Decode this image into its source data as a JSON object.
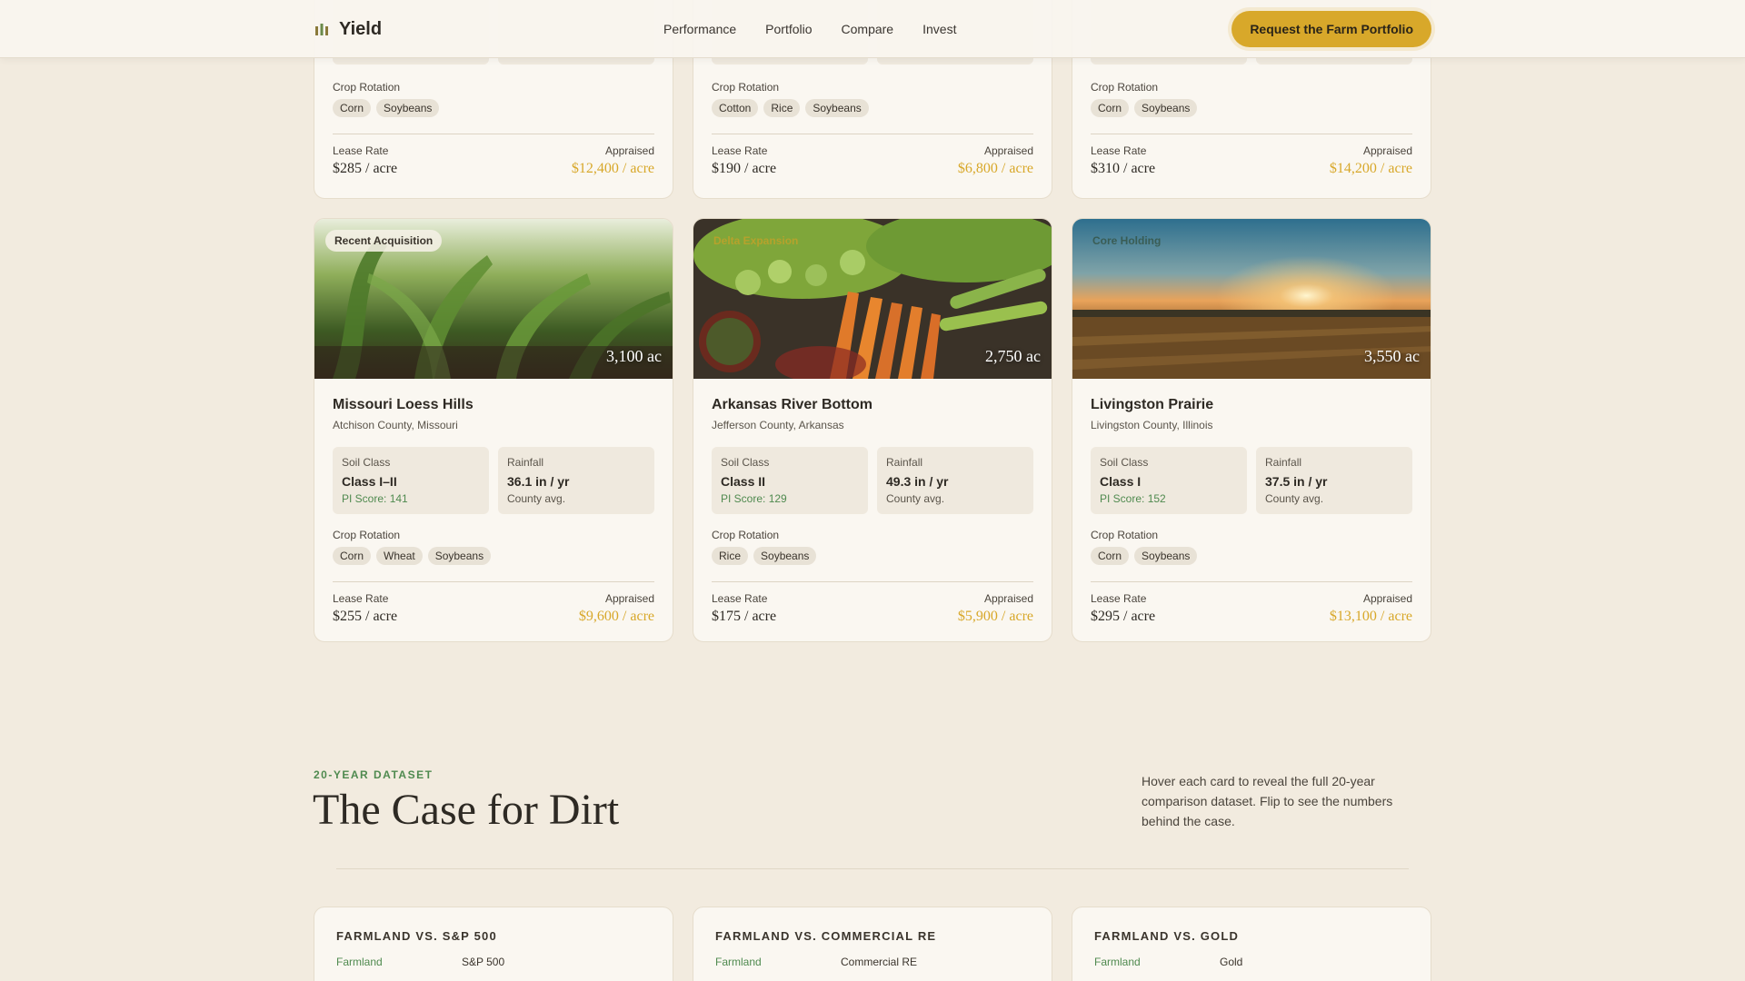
{
  "header": {
    "brand": "Yield",
    "nav": [
      "Performance",
      "Portfolio",
      "Compare",
      "Invest"
    ],
    "cta": "Request the Farm Portfolio"
  },
  "top_cards": [
    {
      "rotation_label": "Crop Rotation",
      "crops": [
        "Corn",
        "Soybeans"
      ],
      "lease_label": "Lease Rate",
      "lease": "$285 / acre",
      "appraised_label": "Appraised",
      "appraised": "$12,400 / acre"
    },
    {
      "rotation_label": "Crop Rotation",
      "crops": [
        "Cotton",
        "Rice",
        "Soybeans"
      ],
      "lease_label": "Lease Rate",
      "lease": "$190 / acre",
      "appraised_label": "Appraised",
      "appraised": "$6,800 / acre"
    },
    {
      "rotation_label": "Crop Rotation",
      "crops": [
        "Corn",
        "Soybeans"
      ],
      "lease_label": "Lease Rate",
      "lease": "$310 / acre",
      "appraised_label": "Appraised",
      "appraised": "$14,200 / acre"
    }
  ],
  "cards": [
    {
      "badge": "Recent Acquisition",
      "acres": "3,100 ac",
      "title": "Missouri Loess Hills",
      "location": "Atchison County, Missouri",
      "soil_label": "Soil Class",
      "soil": "Class I–II",
      "pi": "PI Score: 141",
      "rain_label": "Rainfall",
      "rain": "36.1 in / yr",
      "rain_note": "County avg.",
      "rotation_label": "Crop Rotation",
      "crops": [
        "Corn",
        "Wheat",
        "Soybeans"
      ],
      "lease_label": "Lease Rate",
      "lease": "$255 / acre",
      "appraised_label": "Appraised",
      "appraised": "$9,600 / acre"
    },
    {
      "badge": "Delta Expansion",
      "acres": "2,750 ac",
      "title": "Arkansas River Bottom",
      "location": "Jefferson County, Arkansas",
      "soil_label": "Soil Class",
      "soil": "Class II",
      "pi": "PI Score: 129",
      "rain_label": "Rainfall",
      "rain": "49.3 in / yr",
      "rain_note": "County avg.",
      "rotation_label": "Crop Rotation",
      "crops": [
        "Rice",
        "Soybeans"
      ],
      "lease_label": "Lease Rate",
      "lease": "$175 / acre",
      "appraised_label": "Appraised",
      "appraised": "$5,900 / acre"
    },
    {
      "badge": "Core Holding",
      "acres": "3,550 ac",
      "title": "Livingston Prairie",
      "location": "Livingston County, Illinois",
      "soil_label": "Soil Class",
      "soil": "Class I",
      "pi": "PI Score: 152",
      "rain_label": "Rainfall",
      "rain": "37.5 in / yr",
      "rain_note": "County avg.",
      "rotation_label": "Crop Rotation",
      "crops": [
        "Corn",
        "Soybeans"
      ],
      "lease_label": "Lease Rate",
      "lease": "$295 / acre",
      "appraised_label": "Appraised",
      "appraised": "$13,100 / acre"
    }
  ],
  "section": {
    "eyebrow": "20-YEAR DATASET",
    "title": "The Case for Dirt",
    "description": "Hover each card to reveal the full 20-year comparison dataset. Flip to see the numbers behind the case."
  },
  "comparisons": [
    {
      "title": "FARMLAND VS. S&P 500",
      "a": "Farmland",
      "b": "S&P 500"
    },
    {
      "title": "FARMLAND VS. COMMERCIAL RE",
      "a": "Farmland",
      "b": "Commercial RE"
    },
    {
      "title": "FARMLAND VS. GOLD",
      "a": "Farmland",
      "b": "Gold"
    }
  ]
}
